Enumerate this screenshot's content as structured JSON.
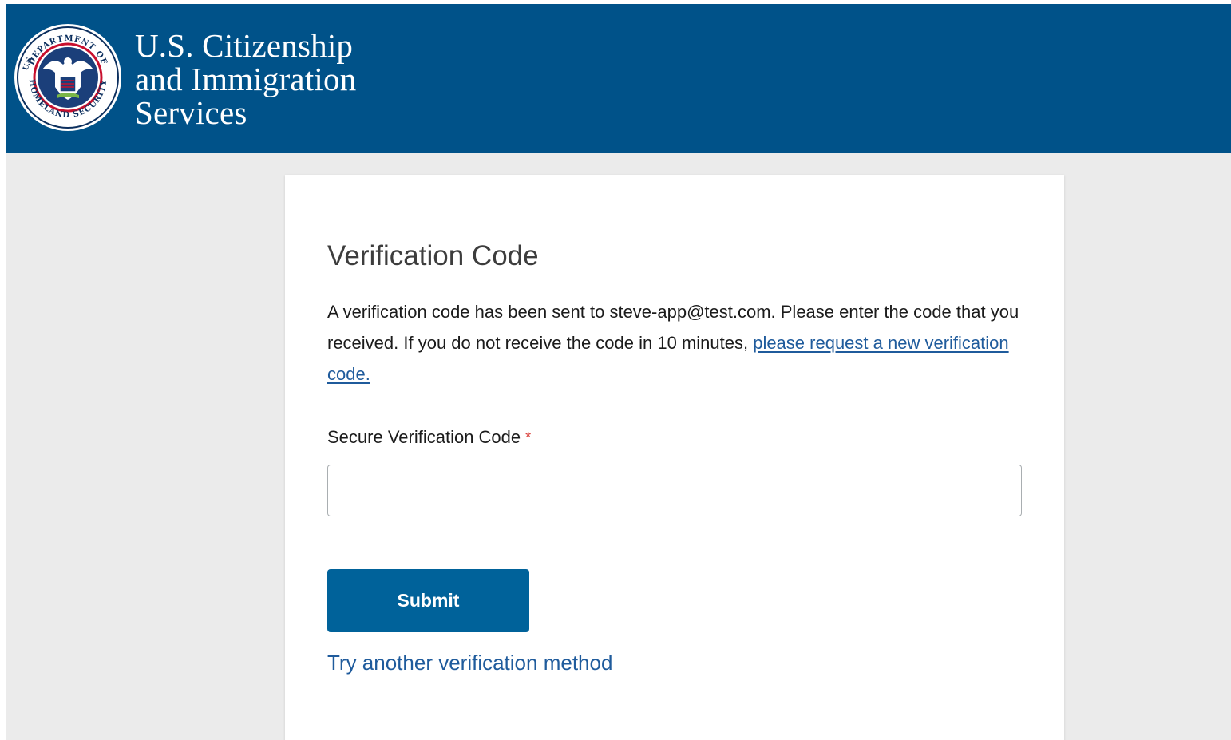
{
  "header": {
    "seal_icon": "dhs-seal-icon",
    "seal_text_top": "DEPARTMENT OF",
    "seal_text_left": "U.S.",
    "seal_text_bottom": "HOMELAND SECURITY",
    "agency_line1": "U.S. Citizenship",
    "agency_line2": "and Immigration",
    "agency_line3": "Services"
  },
  "card": {
    "title": "Verification Code",
    "description_prefix": "A verification code has been sent to steve-app@test.com. Please enter the code that you received. If you do not receive the code in 10 minutes, ",
    "resend_link": "please request a new verification code.",
    "field_label": "Secure Verification Code",
    "required_marker": "*",
    "input_value": "",
    "input_placeholder": "",
    "submit_label": "Submit",
    "alt_method_link": "Try another verification method"
  },
  "colors": {
    "brand": "#005289",
    "button": "#00629a",
    "link": "#1f5b9c",
    "required": "#d83933",
    "page_bg": "#ebebeb"
  }
}
